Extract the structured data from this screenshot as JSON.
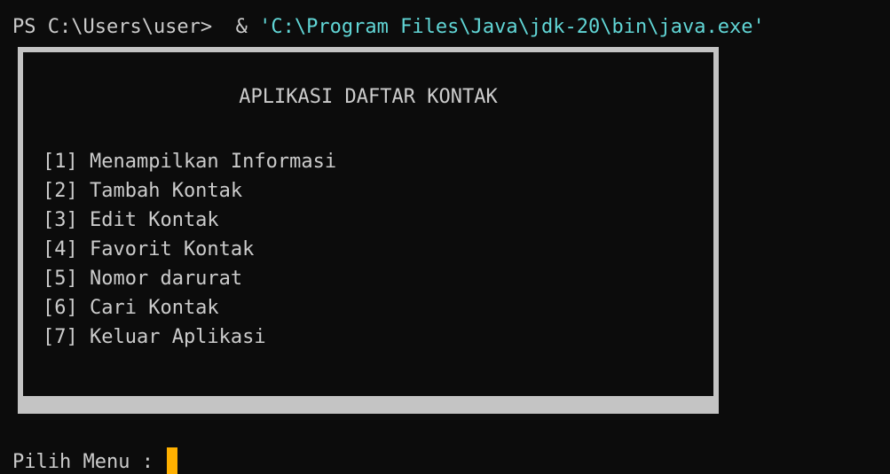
{
  "command_line": {
    "prompt": "PS C:\\Users\\user>",
    "operator": "&",
    "path": "'C:\\Program Files\\Java\\jdk-20\\bin\\java.exe'"
  },
  "menu": {
    "title": "APLIKASI DAFTAR KONTAK",
    "items": [
      {
        "label": "[1] Menampilkan Informasi"
      },
      {
        "label": "[2] Tambah Kontak"
      },
      {
        "label": "[3] Edit Kontak"
      },
      {
        "label": "[4] Favorit Kontak"
      },
      {
        "label": "[5] Nomor darurat"
      },
      {
        "label": "[6] Cari Kontak"
      },
      {
        "label": "[7] Keluar Aplikasi"
      }
    ]
  },
  "prompt": {
    "label": "Pilih Menu :"
  },
  "colors": {
    "background": "#0c0c0c",
    "text": "#cccccc",
    "path": "#61d6d6",
    "frame": "#c4c4c4",
    "cursor": "#ffb000"
  }
}
